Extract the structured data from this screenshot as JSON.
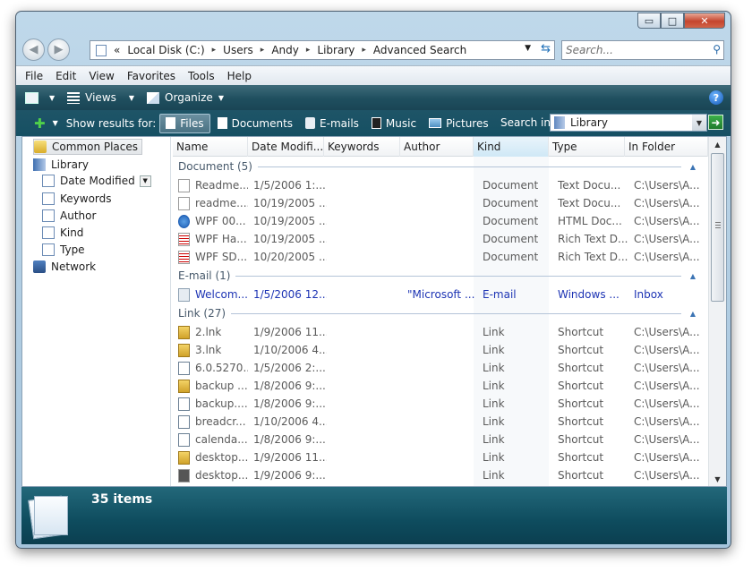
{
  "window": {
    "minimize": "▭",
    "maximize": "□",
    "close": "✕"
  },
  "address": {
    "root": "«",
    "crumbs": [
      "Local Disk (C:)",
      "Users",
      "Andy",
      "Library",
      "Advanced Search"
    ],
    "search_placeholder": "Search..."
  },
  "menu": [
    "File",
    "Edit",
    "View",
    "Favorites",
    "Tools",
    "Help"
  ],
  "commands": {
    "views": "Views",
    "organize": "Organize"
  },
  "search_pane": {
    "show_results": "Show results for:",
    "filters": [
      "Files",
      "Documents",
      "E-mails",
      "Music",
      "Pictures"
    ],
    "active_filter": "Files",
    "search_in_label": "Search in:",
    "search_in_value": "Library"
  },
  "nav": {
    "common_places": "Common Places",
    "library": "Library",
    "sub": [
      "Date Modified",
      "Keywords",
      "Author",
      "Kind",
      "Type"
    ],
    "network": "Network"
  },
  "columns": [
    "Name",
    "Date Modifi...",
    "Keywords",
    "Author",
    "Kind",
    "Type",
    "In Folder"
  ],
  "groups": {
    "document": {
      "label": "Document (5)",
      "rows": [
        {
          "icon": "text-file-icon",
          "name": "Readme...",
          "date": "1/5/2006 1:...",
          "keywords": "",
          "author": "",
          "kind": "Document",
          "type": "Text Docu...",
          "folder": "C:\\Users\\A..."
        },
        {
          "icon": "text-file-icon",
          "name": "readme....",
          "date": "10/19/2005 ...",
          "keywords": "",
          "author": "",
          "kind": "Document",
          "type": "Text Docu...",
          "folder": "C:\\Users\\A..."
        },
        {
          "icon": "html-file-icon",
          "name": "WPF 00...",
          "date": "10/19/2005 ...",
          "keywords": "",
          "author": "",
          "kind": "Document",
          "type": "HTML Doc...",
          "folder": "C:\\Users\\A..."
        },
        {
          "icon": "rtf-file-icon",
          "name": "WPF Ha...",
          "date": "10/19/2005 ...",
          "keywords": "",
          "author": "",
          "kind": "Document",
          "type": "Rich Text D...",
          "folder": "C:\\Users\\A..."
        },
        {
          "icon": "rtf-file-icon",
          "name": "WPF SD...",
          "date": "10/20/2005 ...",
          "keywords": "",
          "author": "",
          "kind": "Document",
          "type": "Rich Text D...",
          "folder": "C:\\Users\\A..."
        }
      ]
    },
    "email": {
      "label": "E-mail (1)",
      "rows": [
        {
          "icon": "email-icon",
          "name": "Welcom...",
          "date": "1/5/2006 12...",
          "keywords": "",
          "author": "\"Microsoft ...",
          "kind": "E-mail",
          "type": "Windows ...",
          "folder": "Inbox"
        }
      ]
    },
    "link": {
      "label": "Link (27)",
      "rows": [
        {
          "icon": "link-file-icon",
          "name": "2.lnk",
          "date": "1/9/2006 11...",
          "keywords": "",
          "author": "",
          "kind": "Link",
          "type": "Shortcut",
          "folder": "C:\\Users\\A..."
        },
        {
          "icon": "link-file-icon",
          "name": "3.lnk",
          "date": "1/10/2006 4...",
          "keywords": "",
          "author": "",
          "kind": "Link",
          "type": "Shortcut",
          "folder": "C:\\Users\\A..."
        },
        {
          "icon": "shortcut-icon",
          "name": "6.0.5270...",
          "date": "1/5/2006 2:...",
          "keywords": "",
          "author": "",
          "kind": "Link",
          "type": "Shortcut",
          "folder": "C:\\Users\\A..."
        },
        {
          "icon": "link-file-icon",
          "name": "backup ...",
          "date": "1/8/2006 9:...",
          "keywords": "",
          "author": "",
          "kind": "Link",
          "type": "Shortcut",
          "folder": "C:\\Users\\A..."
        },
        {
          "icon": "shortcut-icon",
          "name": "backup....",
          "date": "1/8/2006 9:...",
          "keywords": "",
          "author": "",
          "kind": "Link",
          "type": "Shortcut",
          "folder": "C:\\Users\\A..."
        },
        {
          "icon": "shortcut-icon",
          "name": "breadcr...",
          "date": "1/10/2006 4...",
          "keywords": "",
          "author": "",
          "kind": "Link",
          "type": "Shortcut",
          "folder": "C:\\Users\\A..."
        },
        {
          "icon": "shortcut-icon",
          "name": "calenda...",
          "date": "1/8/2006 9:...",
          "keywords": "",
          "author": "",
          "kind": "Link",
          "type": "Shortcut",
          "folder": "C:\\Users\\A..."
        },
        {
          "icon": "link-file-icon",
          "name": "desktop...",
          "date": "1/9/2006 11...",
          "keywords": "",
          "author": "",
          "kind": "Link",
          "type": "Shortcut",
          "folder": "C:\\Users\\A..."
        },
        {
          "icon": "shortcut-dark-icon",
          "name": "desktop...",
          "date": "1/9/2006 9:...",
          "keywords": "",
          "author": "",
          "kind": "Link",
          "type": "Shortcut",
          "folder": "C:\\Users\\A..."
        }
      ]
    }
  },
  "details": {
    "count": "35 items"
  }
}
